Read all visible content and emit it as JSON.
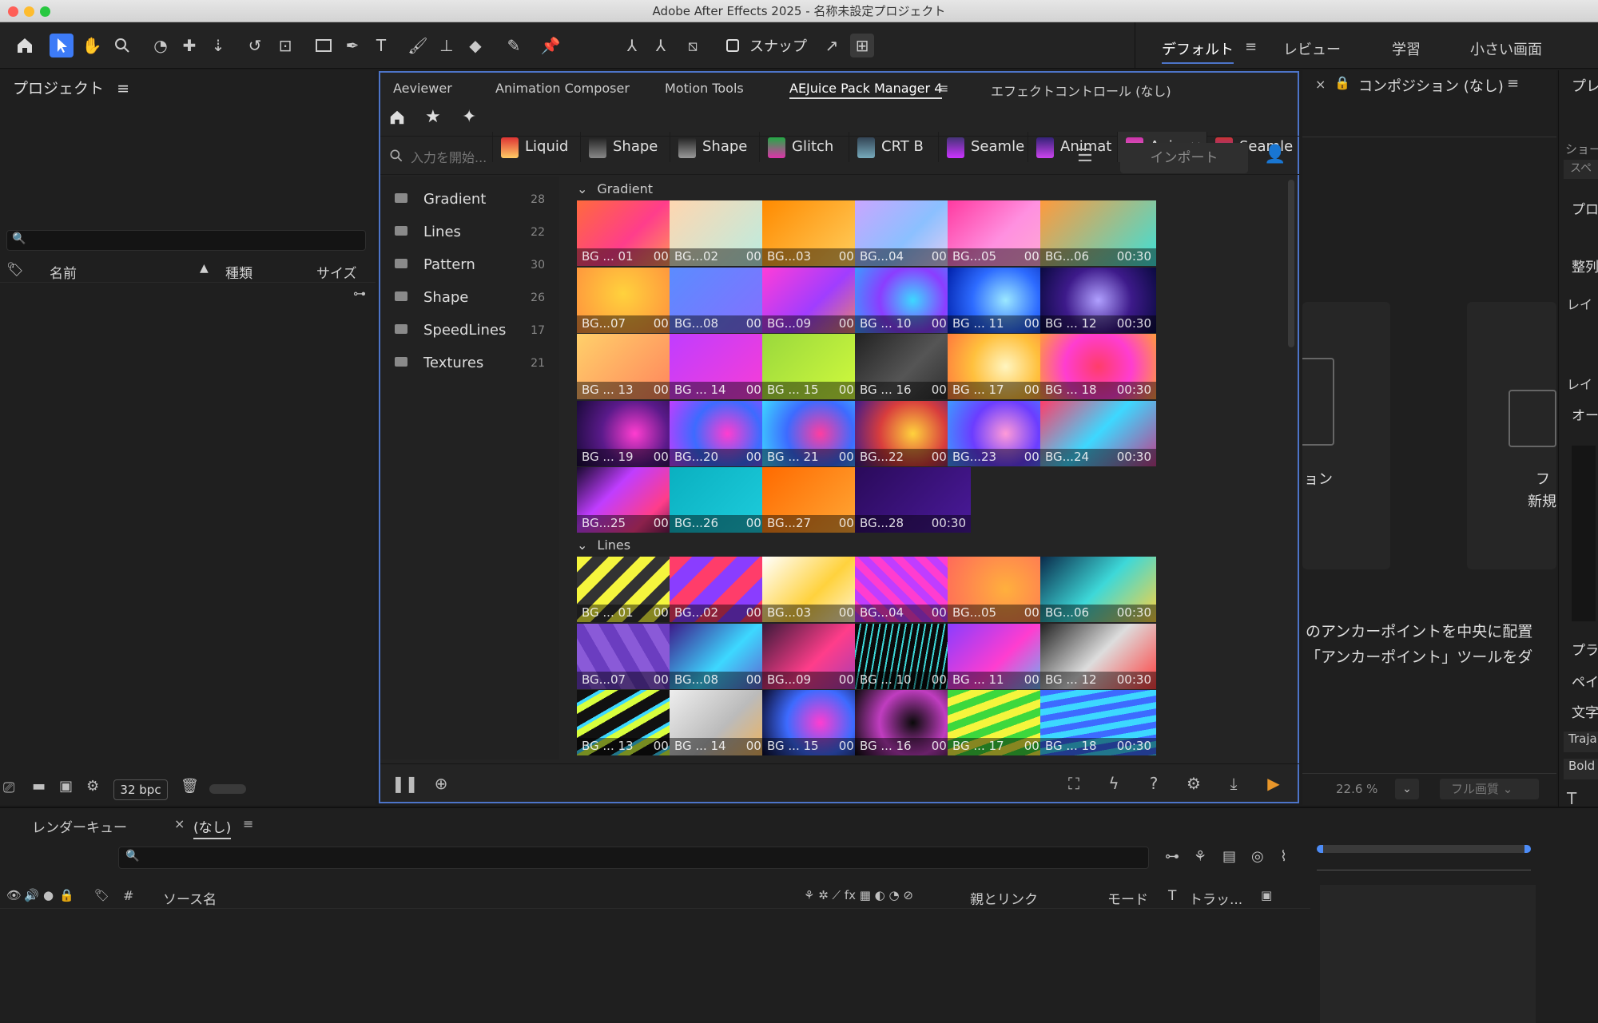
{
  "app": {
    "title": "Adobe After Effects 2025 - 名称未設定プロジェクト"
  },
  "colors": {
    "accent": "#4d74c8",
    "panel_bg": "#242424",
    "orange": "#e8962a"
  },
  "toolbar": {
    "snap_label": "スナップ",
    "tools": [
      "home-icon",
      "selection-icon",
      "hand-icon",
      "zoom-icon",
      "orbit-icon",
      "track-xy-icon",
      "track-z-icon",
      "rotate-icon",
      "anchor-icon",
      "rectangle-icon",
      "pen-icon",
      "type-icon",
      "brush-icon",
      "clone-stamp-icon",
      "eraser-icon",
      "roto-brush-icon",
      "puppet-pin-icon"
    ]
  },
  "workspaces": [
    {
      "label": "デフォルト",
      "active": true
    },
    {
      "label": "レビュー"
    },
    {
      "label": "学習"
    },
    {
      "label": "小さい画面"
    }
  ],
  "project": {
    "title": "プロジェクト",
    "columns": {
      "name": "名前",
      "type": "種類",
      "size": "サイズ"
    },
    "bpc": "32 bpc"
  },
  "aejuice": {
    "panel_tabs": [
      "Aeviewer",
      "Animation Composer",
      "Motion Tools",
      "AEJuice Pack Manager 4",
      "エフェクトコントロール (なし)"
    ],
    "pack_tabs": [
      "Liquid",
      "Shape",
      "Shape",
      "Glitch",
      "CRT B",
      "Seamle",
      "Animat",
      "Anima",
      "Seamle"
    ],
    "search_placeholder": "入力を開始...",
    "import_label": "インポート",
    "categories": [
      {
        "name": "Gradient",
        "count": "28"
      },
      {
        "name": "Lines",
        "count": "22"
      },
      {
        "name": "Pattern",
        "count": "30"
      },
      {
        "name": "Shape",
        "count": "26"
      },
      {
        "name": "SpeedLines",
        "count": "17"
      },
      {
        "name": "Textures",
        "count": "21"
      }
    ],
    "sections": [
      {
        "title": "Gradient",
        "items": [
          "BG ... 01",
          "BG...02",
          "BG...03",
          "BG...04",
          "BG...05",
          "BG...06",
          "BG...07",
          "BG...08",
          "BG...09",
          "BG ... 10",
          "BG ... 11",
          "BG ... 12",
          "BG ... 13",
          "BG ... 14",
          "BG ... 15",
          "BG ... 16",
          "BG ... 17",
          "BG ... 18",
          "BG ... 19",
          "BG...20",
          "BG ... 21",
          "BG...22",
          "BG...23",
          "BG...24",
          "BG...25",
          "BG...26",
          "BG...27",
          "BG...28"
        ]
      },
      {
        "title": "Lines",
        "items": [
          "BG ... 01",
          "BG...02",
          "BG...03",
          "BG...04",
          "BG...05",
          "BG...06",
          "BG...07",
          "BG...08",
          "BG...09",
          "BG ... 10",
          "BG ... 11",
          "BG ... 12",
          "BG ... 13",
          "BG ... 14",
          "BG ... 15",
          "BG ... 16",
          "BG ... 17",
          "BG ... 18"
        ]
      }
    ],
    "duration": "00:30"
  },
  "comp": {
    "title": "コンポジション (なし)",
    "text_line1": "のアンカーポイントを中央に配置",
    "text_line2": "「アンカーポイント」ツールをダ",
    "caption_left": "ョン",
    "caption_right1": "フ",
    "caption_right2": "新規",
    "zoom": "22.6 %",
    "quality": "フル画質"
  },
  "right": {
    "items": [
      "プレ",
      "ショー",
      "スペ",
      "プロ",
      "整列",
      "レイ",
      "レイ",
      "オー",
      "プラ",
      "ペイ",
      "文字",
      "Traja",
      "Bold"
    ]
  },
  "timeline": {
    "render_tab": "レンダーキュー",
    "comp_tab": "(なし)",
    "columns": {
      "source": "ソース名",
      "parent": "親とリンク",
      "mode": "モード",
      "t": "T",
      "track": "トラッ..."
    },
    "num": "#"
  }
}
